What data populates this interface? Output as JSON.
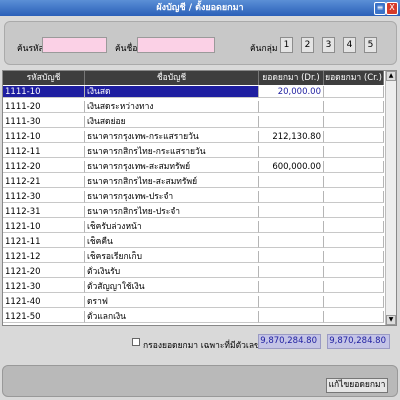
{
  "window": {
    "title": "ผังบัญชี / ตั้งยอดยกมา",
    "min_glyph": "≡",
    "close_glyph": "X"
  },
  "search": {
    "code_label": "ค้นรหัส",
    "name_label": "ค้นชื่อ",
    "group_label": "ค้นกลุ่ม",
    "code_value": "",
    "name_value": "",
    "groups": [
      "1",
      "2",
      "3",
      "4",
      "5"
    ]
  },
  "table": {
    "headers": [
      "รหัสบัญชี",
      "ชื่อบัญชี",
      "ยอดยกมา (Dr.)",
      "ยอดยกมา (Cr.)"
    ],
    "rows": [
      {
        "code": "1111-10",
        "name": "เงินสด",
        "dr": "20,000.00",
        "cr": ""
      },
      {
        "code": "1111-20",
        "name": "เงินสดระหว่างทาง",
        "dr": "",
        "cr": ""
      },
      {
        "code": "1111-30",
        "name": "เงินสดย่อย",
        "dr": "",
        "cr": ""
      },
      {
        "code": "1112-10",
        "name": "ธนาคารกรุงเทพ-กระแสรายวัน",
        "dr": "212,130.80",
        "cr": ""
      },
      {
        "code": "1112-11",
        "name": "ธนาคารกสิกรไทย-กระแสรายวัน",
        "dr": "",
        "cr": ""
      },
      {
        "code": "1112-20",
        "name": "ธนาคารกรุงเทพ-สะสมทรัพย์",
        "dr": "600,000.00",
        "cr": ""
      },
      {
        "code": "1112-21",
        "name": "ธนาคารกสิกรไทย-สะสมทรัพย์",
        "dr": "",
        "cr": ""
      },
      {
        "code": "1112-30",
        "name": "ธนาคารกรุงเทพ-ประจำ",
        "dr": "",
        "cr": ""
      },
      {
        "code": "1112-31",
        "name": "ธนาคารกสิกรไทย-ประจำ",
        "dr": "",
        "cr": ""
      },
      {
        "code": "1121-10",
        "name": "เช็ครับล่วงหน้า",
        "dr": "",
        "cr": ""
      },
      {
        "code": "1121-11",
        "name": "เช็คคืน",
        "dr": "",
        "cr": ""
      },
      {
        "code": "1121-12",
        "name": "เช็ครอเรียกเก็บ",
        "dr": "",
        "cr": ""
      },
      {
        "code": "1121-20",
        "name": "ตั๋วเงินรับ",
        "dr": "",
        "cr": ""
      },
      {
        "code": "1121-30",
        "name": "ตั๋วสัญญาใช้เงิน",
        "dr": "",
        "cr": ""
      },
      {
        "code": "1121-40",
        "name": "ดราฟ",
        "dr": "",
        "cr": ""
      },
      {
        "code": "1121-50",
        "name": "ตั๋วแลกเงิน",
        "dr": "",
        "cr": ""
      }
    ]
  },
  "footer": {
    "checkbox_label": "กรองยอดยกมา เฉพาะที่มีตัวเลข",
    "total_dr": "9,870,284.80",
    "total_cr": "9,870,284.80"
  },
  "actions": {
    "save_label": "แก้ไขยอดยกมา"
  },
  "colors": {
    "title_bar": "#2a5fb8",
    "selection": "#1e1ea0",
    "pink_input": "#fbd1e6",
    "total_box": "#c4c4e6"
  }
}
